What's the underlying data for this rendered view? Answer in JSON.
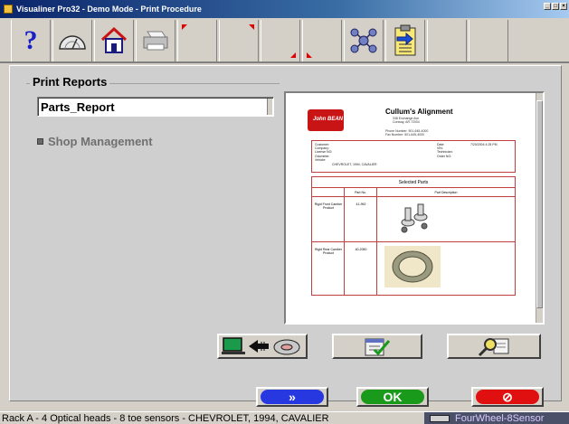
{
  "window": {
    "title": "Visualiner Pro32 - Demo Mode - Print Procedure",
    "controls": [
      "_",
      "□",
      "×"
    ]
  },
  "toolbar": {
    "buttons": [
      {
        "name": "help",
        "icon": "help-icon",
        "glyph": "?"
      },
      {
        "name": "gauge",
        "icon": "gauge-icon"
      },
      {
        "name": "home",
        "icon": "home-icon"
      },
      {
        "name": "print",
        "icon": "printer-icon"
      },
      {
        "name": "corner-1",
        "icon": "red-corner-marker-icon"
      },
      {
        "name": "corner-2",
        "icon": "red-corner-marker-icon"
      },
      {
        "name": "corner-3",
        "icon": "red-corner-marker-icon"
      },
      {
        "name": "corner-4",
        "icon": "red-corner-marker-icon"
      },
      {
        "name": "network",
        "icon": "network-icon"
      },
      {
        "name": "clipboard",
        "icon": "clipboard-arrow-icon"
      },
      {
        "name": "empty-1",
        "icon": ""
      },
      {
        "name": "empty-2",
        "icon": ""
      }
    ]
  },
  "print_reports": {
    "group_title": "Print Reports",
    "selected_report": "Parts_Report",
    "tree_items": [
      {
        "label": "Shop Management"
      }
    ]
  },
  "preview": {
    "company_name": "Cullum's Alignment",
    "company_addr_1": "338 Exchange Ave",
    "company_addr_2": "Conway, AR 72034",
    "phone": "Phone Number: 501-645-4000",
    "fax": "Fax Number: 501-645-4000",
    "logo_text": "John BEAN",
    "info_left": [
      "Customer:",
      "Company:",
      "License NO:",
      "Odometer:",
      "Vehicle:"
    ],
    "info_right": [
      "Date:",
      "VIN:",
      "Technician:",
      "Order NO:"
    ],
    "date_value": "7/20/2004 4:25 PM",
    "vehicle_value": "CHEVROLET, 1994, CAVALIER",
    "parts_title": "Selected Parts",
    "columns": [
      "",
      "Part No.",
      "Part Description"
    ],
    "rows": [
      {
        "label": "Rigid Front Camber Product",
        "part_no": "41-992",
        "image": "camber-bolt-image"
      },
      {
        "label": "Rigid Rear Camber Product",
        "part_no": "40-2050",
        "image": "shim-ring-image"
      }
    ]
  },
  "actions": [
    {
      "name": "transfer",
      "icon": "computer-to-disk-icon"
    },
    {
      "name": "edit",
      "icon": "checklist-icon"
    },
    {
      "name": "zoom",
      "icon": "magnifier-icon"
    }
  ],
  "nav": {
    "next_glyph": "»",
    "ok_label": "OK",
    "cancel_glyph": "⊘",
    "colors": {
      "next": "#2838e0",
      "ok": "#1a9a1a",
      "cancel": "#e01010"
    }
  },
  "status": {
    "text": "Rack A - 4 Optical heads - 8 toe sensors - CHEVROLET, 1994, CAVALIER",
    "sensor": "FourWheel-8Sensor"
  }
}
